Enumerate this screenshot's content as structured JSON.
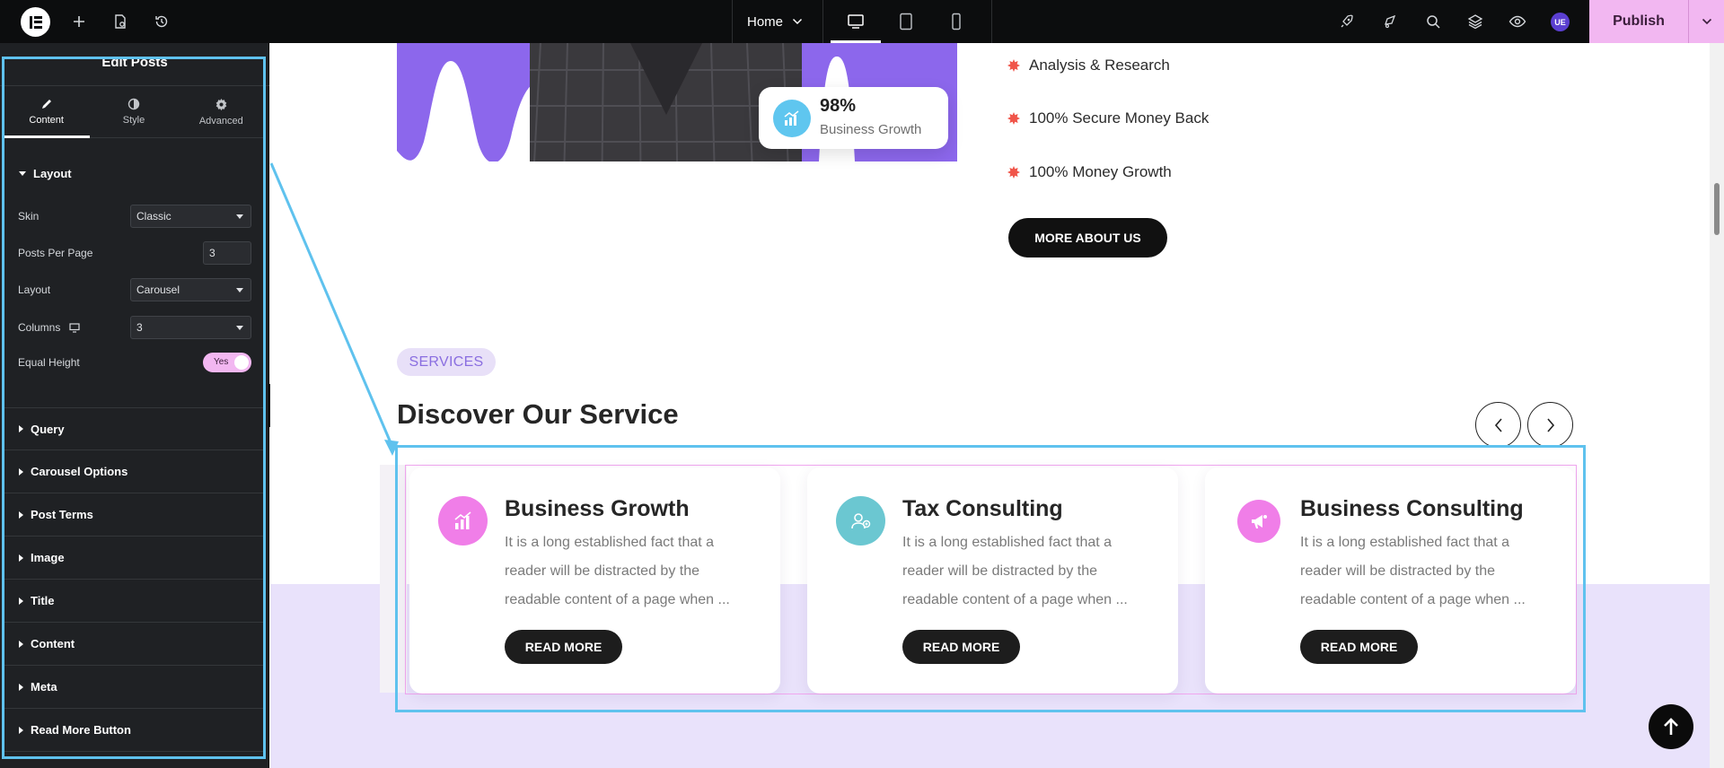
{
  "topbar": {
    "page_name": "Home",
    "publish_label": "Publish",
    "avatar_initials": "UE"
  },
  "panel": {
    "title": "Edit Posts",
    "tabs": [
      {
        "label": "Content",
        "icon": "pencil-icon",
        "active": true
      },
      {
        "label": "Style",
        "icon": "half-circle-icon",
        "active": false
      },
      {
        "label": "Advanced",
        "icon": "gear-icon",
        "active": false
      }
    ],
    "layout_section": {
      "title": "Layout",
      "expanded": true,
      "controls": {
        "skin": {
          "label": "Skin",
          "value": "Classic"
        },
        "posts_per_page": {
          "label": "Posts Per Page",
          "value": "3"
        },
        "layout": {
          "label": "Layout",
          "value": "Carousel"
        },
        "columns": {
          "label": "Columns",
          "value": "3"
        },
        "equal_height": {
          "label": "Equal Height",
          "value": "Yes"
        }
      }
    },
    "collapsed_sections": [
      "Query",
      "Carousel Options",
      "Post Terms",
      "Image",
      "Title",
      "Content",
      "Meta",
      "Read More Button"
    ]
  },
  "canvas": {
    "stat": {
      "value": "98%",
      "label": "Business Growth"
    },
    "features": [
      "Analysis & Research",
      "100% Secure Money Back",
      "100% Money Growth"
    ],
    "about_button": "MORE ABOUT US",
    "services_tag": "SERVICES",
    "heading": "Discover Our Service",
    "cards": [
      {
        "title": "Business Growth",
        "text": "It is a long established fact that a reader will be distracted by the readable content of a page when ...",
        "button": "READ MORE",
        "icon": "chart-growth-icon",
        "icon_color": "#f07ee8"
      },
      {
        "title": "Tax Consulting",
        "text": "It is a long established fact that a reader will be distracted by the readable content of a page when ...",
        "button": "READ MORE",
        "icon": "consultant-icon",
        "icon_color": "#6bc7d1"
      },
      {
        "title": "Business Consulting",
        "text": "It is a long established fact that a reader will be distracted by the readable content of a page when ...",
        "button": "READ MORE",
        "icon": "megaphone-icon",
        "icon_color": "#f07ee8"
      }
    ]
  },
  "colors": {
    "accent_pink": "#f2b7f1",
    "selection_blue": "#5fc2ee",
    "hero_purple": "#8c67ec",
    "band_lavender": "#e9e2fb"
  }
}
